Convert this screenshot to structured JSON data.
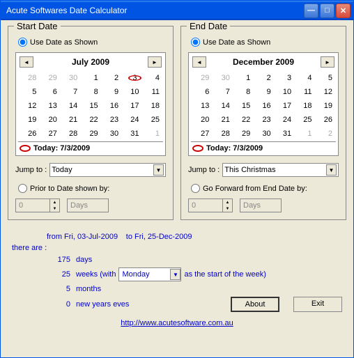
{
  "window": {
    "title": "Acute Softwares Date Calculator"
  },
  "start": {
    "title": "Start Date",
    "use_as_shown": "Use Date as Shown",
    "month": "July 2009",
    "days": [
      "28",
      "29",
      "30",
      "1",
      "2",
      "3",
      "4",
      "5",
      "6",
      "7",
      "8",
      "9",
      "10",
      "11",
      "12",
      "13",
      "14",
      "15",
      "16",
      "17",
      "18",
      "19",
      "20",
      "21",
      "22",
      "23",
      "24",
      "25",
      "26",
      "27",
      "28",
      "29",
      "30",
      "31",
      "1"
    ],
    "today": "Today: 7/3/2009",
    "jump_label": "Jump to :",
    "jump_value": "Today",
    "prior_label": "Prior to Date shown by:",
    "num": "0",
    "unit": "Days"
  },
  "end": {
    "title": "End Date",
    "use_as_shown": "Use Date as Shown",
    "month": "December 2009",
    "days": [
      "29",
      "30",
      "1",
      "2",
      "3",
      "4",
      "5",
      "6",
      "7",
      "8",
      "9",
      "10",
      "11",
      "12",
      "13",
      "14",
      "15",
      "16",
      "17",
      "18",
      "19",
      "20",
      "21",
      "22",
      "23",
      "24",
      "25",
      "26",
      "27",
      "28",
      "29",
      "30",
      "31",
      "1",
      "2"
    ],
    "today": "Today: 7/3/2009",
    "jump_label": "Jump to :",
    "jump_value": "This Christmas",
    "forward_label": "Go Forward from End Date by:",
    "num": "0",
    "unit": "Days"
  },
  "results": {
    "from": "from Fri, 03-Jul-2009",
    "to": "to Fri, 25-Dec-2009",
    "there": "there are :",
    "days_n": "175",
    "days_l": "days",
    "weeks_n": "25",
    "weeks_l1": "weeks (with",
    "weeks_day": "Monday",
    "weeks_l2": "as the start of the week)",
    "months_n": "5",
    "months_l": "months",
    "nye_n": "0",
    "nye_l": "new years eves"
  },
  "buttons": {
    "about": "About",
    "exit": "Exit"
  },
  "link": "http://www.acutesoftware.com.au"
}
